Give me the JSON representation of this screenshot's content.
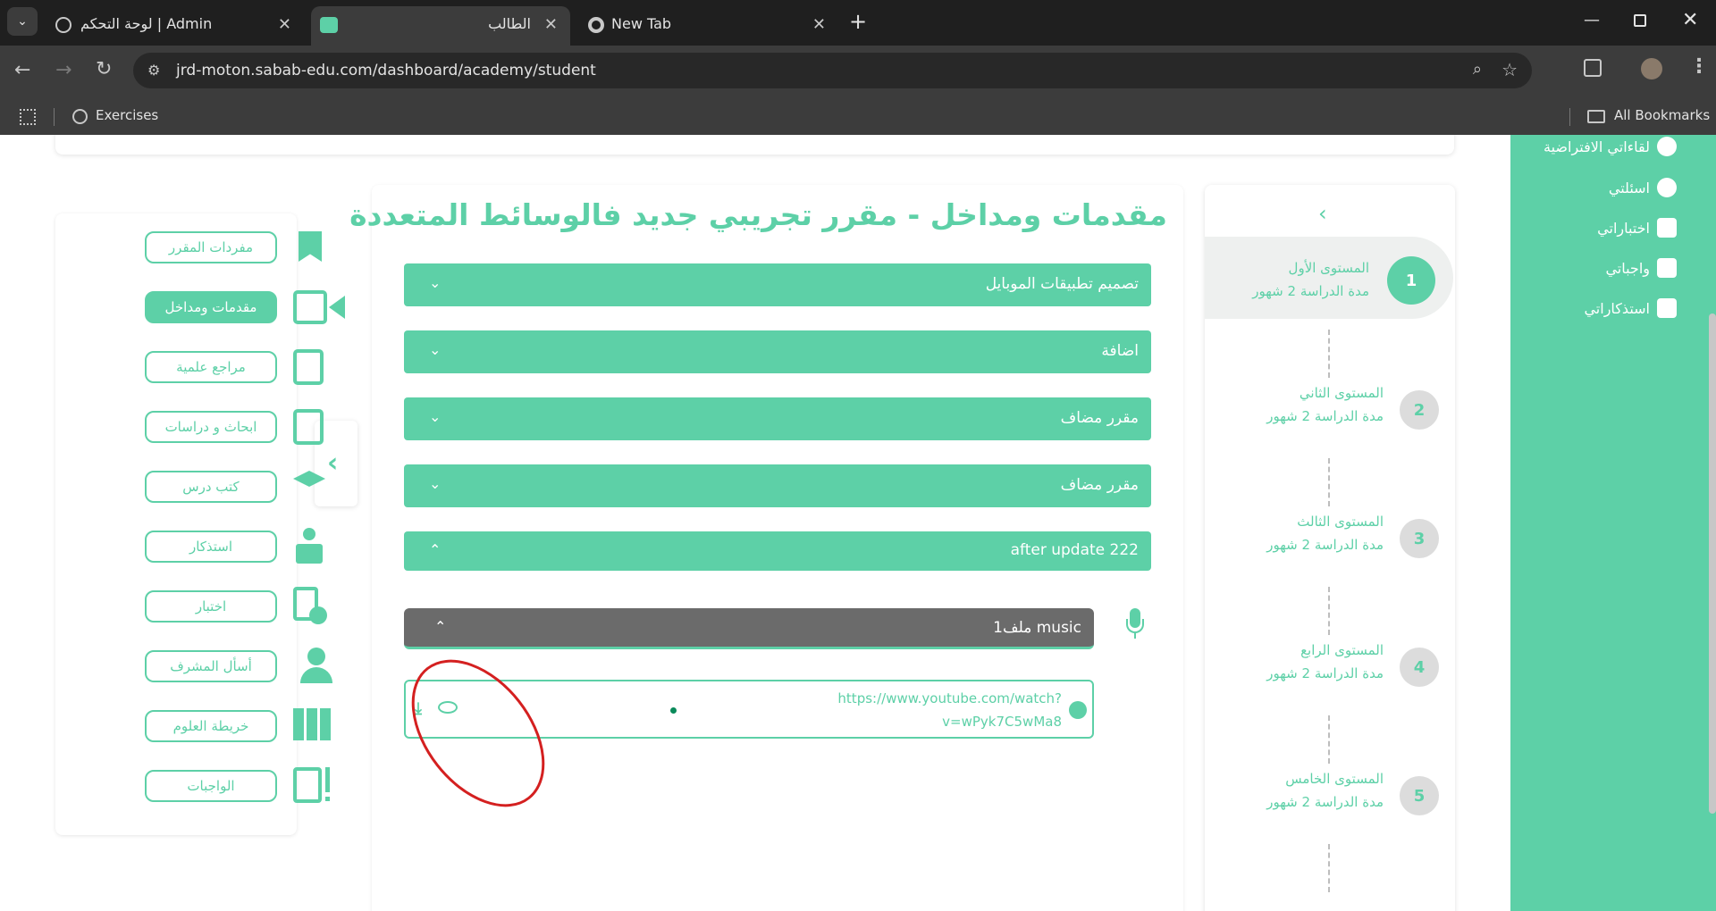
{
  "browser": {
    "tabs": [
      {
        "title": "لوحة التحكم | Admin"
      },
      {
        "title": "الطالب"
      },
      {
        "title": "New Tab"
      }
    ],
    "url": "jrd-moton.sabab-edu.com/dashboard/academy/student",
    "bookmarks": {
      "exercises": "Exercises",
      "all": "All Bookmarks"
    }
  },
  "right_nav": {
    "items": [
      {
        "label": "لقاءاتي الافتراضية",
        "icon": "chat-icon"
      },
      {
        "label": "اسئلتي",
        "icon": "question-icon"
      },
      {
        "label": "اختباراتي",
        "icon": "exam-icon"
      },
      {
        "label": "واجباتي",
        "icon": "homework-icon"
      },
      {
        "label": "استذكاراتي",
        "icon": "study-icon"
      }
    ]
  },
  "levels": [
    {
      "num": "1",
      "title": "المستوى الأول",
      "sub": "مدة الدراسة 2 شهور",
      "active": true
    },
    {
      "num": "2",
      "title": "المستوى الثاني",
      "sub": "مدة الدراسة 2 شهور"
    },
    {
      "num": "3",
      "title": "المستوى الثالث",
      "sub": "مدة الدراسة 2 شهور"
    },
    {
      "num": "4",
      "title": "المستوى الرابع",
      "sub": "مدة الدراسة 2 شهور"
    },
    {
      "num": "5",
      "title": "المستوى الخامس",
      "sub": "مدة الدراسة 2 شهور"
    }
  ],
  "main": {
    "title": "مقدمات ومداخل - مقرر تجريبي جديد فالوسائط المتعددة",
    "accordions": [
      {
        "label": "تصميم تطبيقات الموبايل",
        "open": false
      },
      {
        "label": "اضافة",
        "open": false
      },
      {
        "label": "مقرر مضاف",
        "open": false
      },
      {
        "label": "مقرر مضاف",
        "open": false
      },
      {
        "label": "after update 222",
        "open": true
      }
    ],
    "file": {
      "label": "1ملف music",
      "link_line1": "https://www.youtube.com/watch?",
      "link_line2": "v=wPyk7C5wMa8"
    }
  },
  "left_menu": {
    "items": [
      {
        "label": "مفردات المقرر"
      },
      {
        "label": "مقدمات ومداخل",
        "active": true
      },
      {
        "label": "مراجع علمية"
      },
      {
        "label": "ابحاث و دراسات"
      },
      {
        "label": "كتب درس"
      },
      {
        "label": "استذكار"
      },
      {
        "label": "اختبار"
      },
      {
        "label": "أسأل المشرف"
      },
      {
        "label": "خريطة العلوم"
      },
      {
        "label": "الواجبات"
      }
    ]
  },
  "colors": {
    "accent": "#5dd0a7",
    "file_bar": "#6b6b6b",
    "annotation": "#d42020"
  }
}
